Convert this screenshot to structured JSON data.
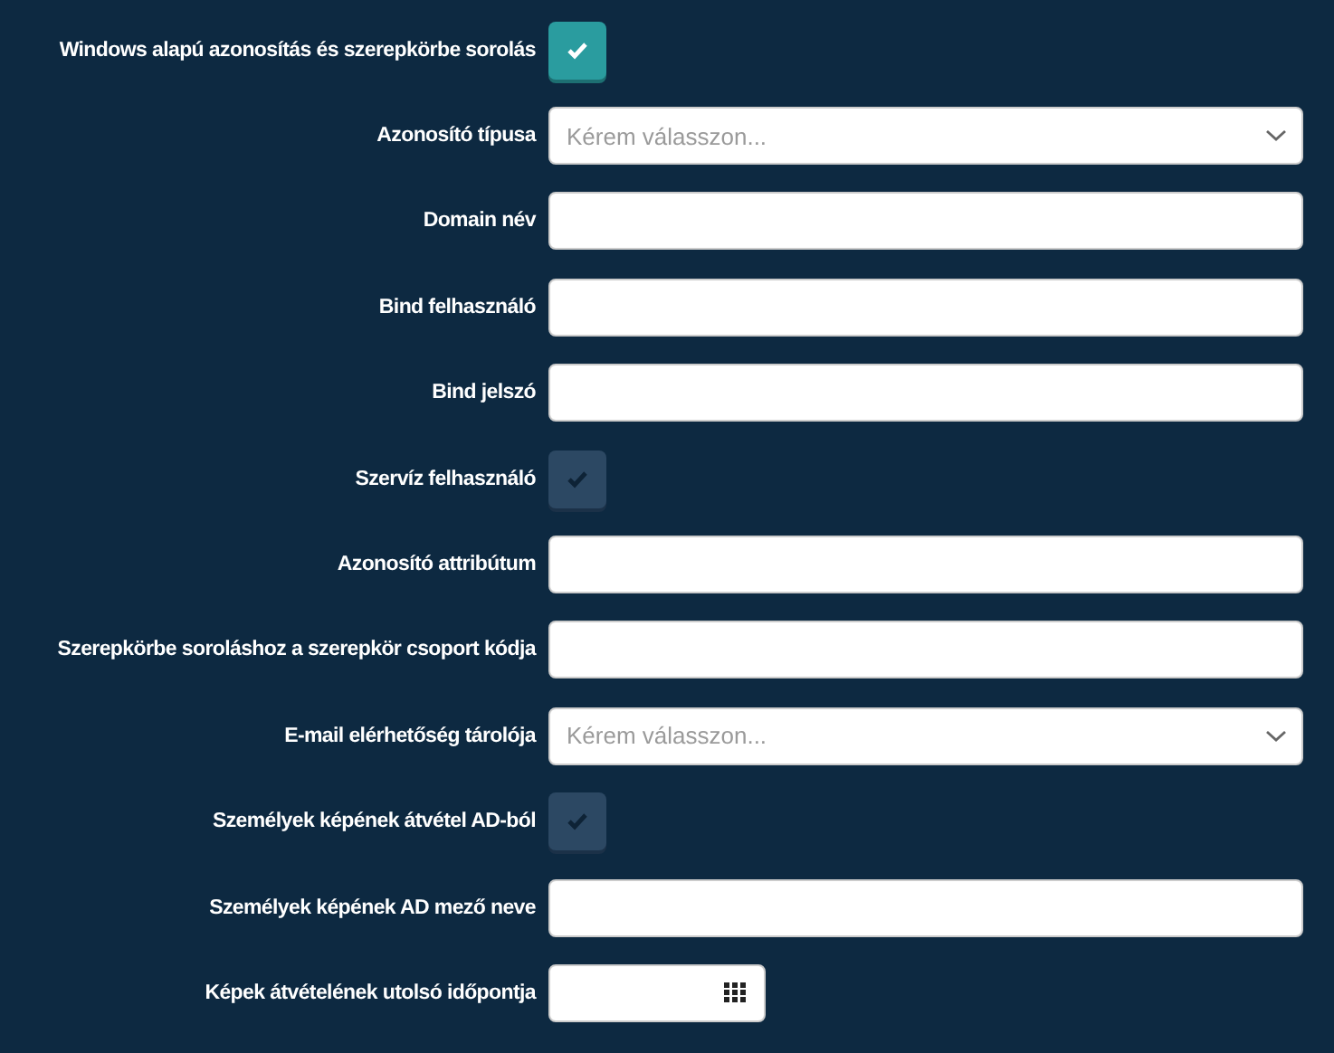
{
  "fields": [
    {
      "kind": "checkbox",
      "label": "Windows alapú azonosítás és szerepkörbe sorolás",
      "checked": true
    },
    {
      "kind": "select",
      "label": "Azonosító típusa",
      "placeholder": "Kérem válasszon..."
    },
    {
      "kind": "text",
      "label": "Domain név"
    },
    {
      "kind": "text",
      "label": "Bind felhasználó"
    },
    {
      "kind": "text",
      "label": "Bind jelszó"
    },
    {
      "kind": "checkbox",
      "label": "Szervíz felhasználó",
      "checked": false
    },
    {
      "kind": "text",
      "label": "Azonosító attribútum"
    },
    {
      "kind": "text",
      "label": "Szerepkörbe soroláshoz a szerepkör csoport kódja"
    },
    {
      "kind": "select",
      "label": "E-mail elérhetőség tárolója",
      "placeholder": "Kérem válasszon..."
    },
    {
      "kind": "checkbox",
      "label": "Személyek képének átvétel AD-ból",
      "checked": false
    },
    {
      "kind": "text",
      "label": "Személyek képének AD mező neve"
    },
    {
      "kind": "date",
      "label": "Képek átvételének utolsó időpontja"
    }
  ]
}
